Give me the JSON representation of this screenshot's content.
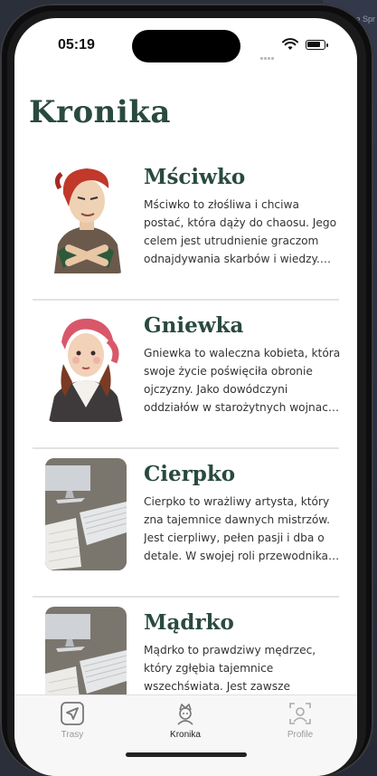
{
  "background": {
    "partial_text": "a Spr"
  },
  "status": {
    "time": "05:19",
    "battery_level": 0.85
  },
  "page": {
    "title": "Kronika"
  },
  "cards": [
    {
      "name": "Mściwko",
      "description": "Mściwko to złośliwa i chciwa postać, która dąży do chaosu. Jego celem jest utrudnienie graczom odnajdywania skarbów i wiedzy. Jako duch chciwości",
      "avatar": "red-haired-man-illustration"
    },
    {
      "name": "Gniewka",
      "description": "Gniewka to waleczna kobieta, która swoje życie poświęciła obronie ojczyzny. Jako dowódczyni oddziałów w starożytnych wojnach, jest odważna",
      "avatar": "woman-red-headscarf-illustration"
    },
    {
      "name": "Cierpko",
      "description": "Cierpko to wrażliwy artysta, który zna tajemnice dawnych mistrzów. Jest cierpliwy, pełen pasji i dba o detale. W swojej roli przewodnika przenosi graczy",
      "avatar": "desk-keyboard-photo"
    },
    {
      "name": "Mądrko",
      "description": "Mądrko to prawdziwy mędrzec, który zgłębia tajemnice wszechświata. Jest zawsze dociekliwy, racjonalny i opiera się",
      "avatar": "desk-keyboard-photo"
    }
  ],
  "tabbar": {
    "items": [
      {
        "label": "Trasy",
        "icon": "navigation-arrow-icon",
        "active": false
      },
      {
        "label": "Kronika",
        "icon": "character-icon",
        "active": true
      },
      {
        "label": "Profile",
        "icon": "profile-icon",
        "active": false
      }
    ]
  },
  "colors": {
    "accent": "#2a4a3f",
    "tab_inactive": "#9a9a9a"
  }
}
